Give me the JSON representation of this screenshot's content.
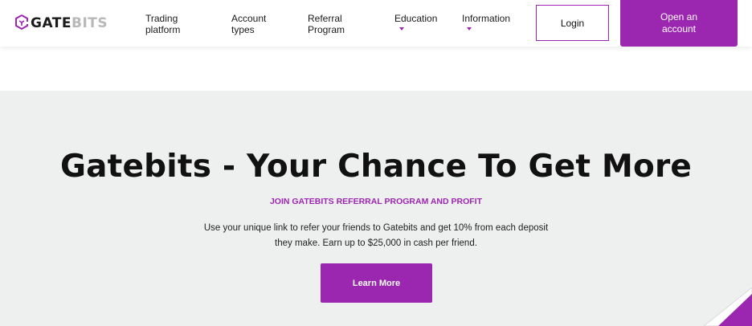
{
  "header": {
    "logo": {
      "primary": "GATE",
      "secondary": "BITS"
    },
    "nav": [
      {
        "line1": "Trading",
        "line2": "platform",
        "dropdown": false
      },
      {
        "line1": "Account",
        "line2": "types",
        "dropdown": false
      },
      {
        "line1": "Referral",
        "line2": "Program",
        "dropdown": false
      },
      {
        "line1": "Education",
        "line2": "",
        "dropdown": true
      },
      {
        "line1": "Information",
        "line2": "",
        "dropdown": true
      }
    ],
    "login_label": "Login",
    "open_account_line1": "Open an",
    "open_account_line2": "account"
  },
  "hero": {
    "title": "Gatebits - Your Chance To Get More",
    "subtitle": "JOIN GATEBITS REFERRAL PROGRAM AND PROFIT",
    "description_line1": "Use your unique link to refer your friends to Gatebits and get 10% from each deposit",
    "description_line2": "they make. Earn up to $25,000 in cash per friend.",
    "cta_label": "Learn More"
  },
  "colors": {
    "accent": "#9b27b0",
    "hero_background": "#eef0ef",
    "header_background": "#ffffff"
  },
  "icons": {
    "logo": "cube-logo-icon",
    "dropdown": "chevron-down-icon"
  }
}
